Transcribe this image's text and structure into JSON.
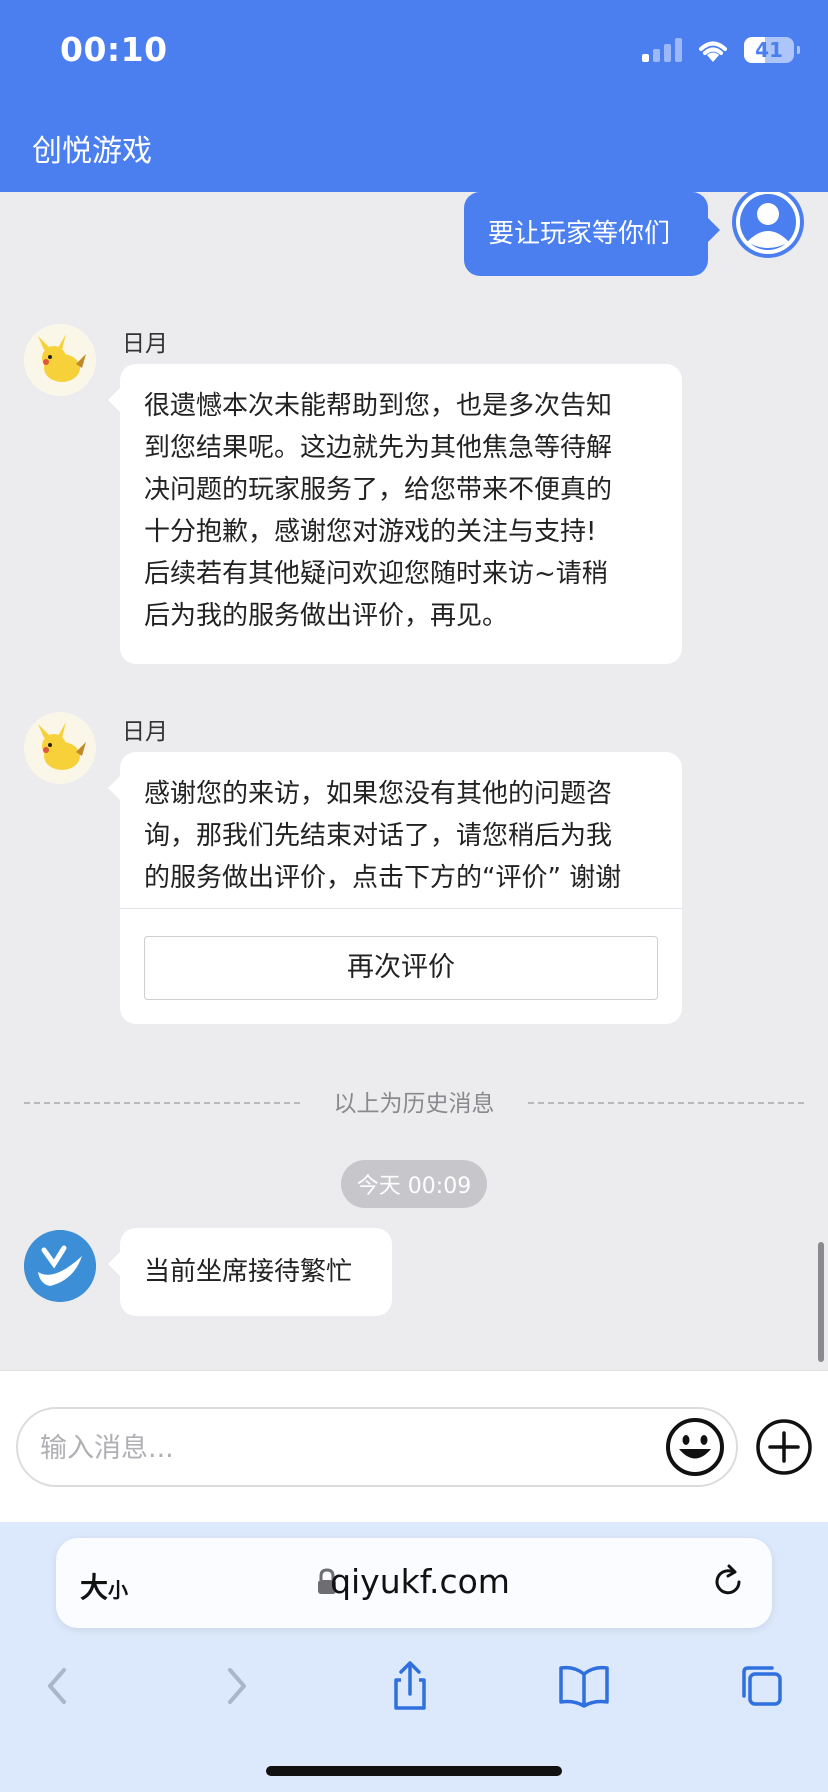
{
  "status_bar": {
    "time": "00:10",
    "battery": "41"
  },
  "header": {
    "title": "创悦游戏"
  },
  "messages": {
    "outgoing_1": "要让玩家等你们",
    "agent_1": {
      "name": "日月",
      "lines": [
        "很遗憾本次未能帮助到您，也是多次告知",
        "到您结果呢。这边就先为其他焦急等待解",
        "决问题的玩家服务了，给您带来不便真的",
        "十分抱歉，感谢您对游戏的关注与支持!",
        "后续若有其他疑问欢迎您随时来访~请稍",
        "后为我的服务做出评价，再见。"
      ]
    },
    "agent_2": {
      "name": "日月",
      "lines": [
        "感谢您的来访，如果您没有其他的问题咨",
        "询，那我们先结束对话了，请您稍后为我",
        "的服务做出评价，点击下方的“评价” 谢谢"
      ],
      "button": "再次评价"
    },
    "history_divider": "以上为历史消息",
    "timestamp": "今天 00:09",
    "bot_1": "当前坐席接待繁忙"
  },
  "composer": {
    "placeholder": "输入消息..."
  },
  "browser": {
    "text_size_big": "大",
    "text_size_small": "小",
    "url": "qiyukf.com"
  },
  "colors": {
    "brand": "#4b7ff0",
    "chat_bg": "#ececee",
    "browser_bg": "#dce8fb"
  }
}
